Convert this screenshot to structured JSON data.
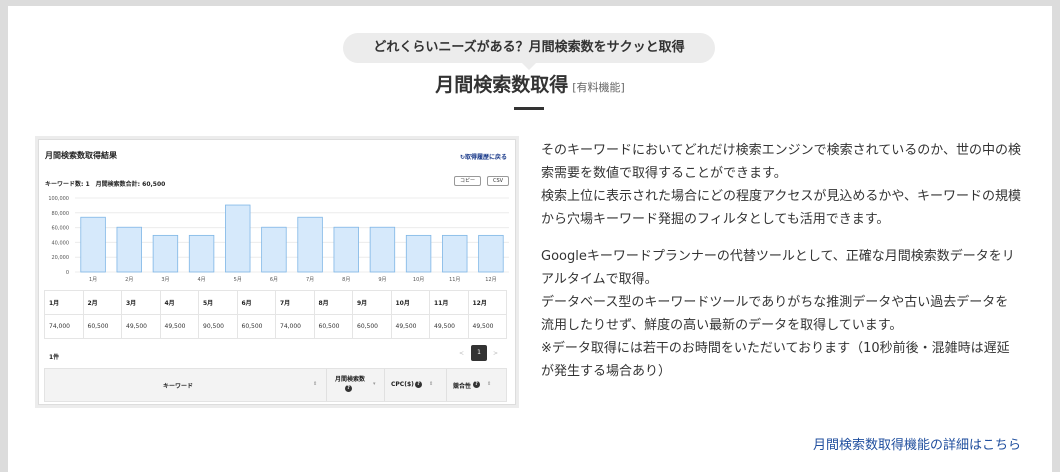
{
  "header": {
    "bubble": "どれくらいニーズがある？月間検索数をサクッと取得",
    "title": "月間検索数取得",
    "title_tag": "[有料機能]"
  },
  "screenshot": {
    "title": "月間検索数取得結果",
    "back_link": "取得履歴に戻る",
    "keyword_count": "キーワード数: 1",
    "monthly_total": "月間検索数合計: 60,500",
    "copy_button": "コピー",
    "csv_button": "CSV",
    "result_count": "1件",
    "page": "1",
    "prev": "<",
    "next": ">",
    "months": [
      "1月",
      "2月",
      "3月",
      "4月",
      "5月",
      "6月",
      "7月",
      "8月",
      "9月",
      "10月",
      "11月",
      "12月"
    ],
    "month_values": [
      "74,000",
      "60,500",
      "49,500",
      "49,500",
      "90,500",
      "60,500",
      "74,000",
      "60,500",
      "60,500",
      "49,500",
      "49,500",
      "49,500"
    ],
    "keyword_table_headers": {
      "keyword": "キーワード",
      "monthly_search": "月間検索数",
      "cpc": "CPC($)",
      "competition": "競合性",
      "help": "?",
      "sort_mark": "⇕",
      "sort_desc": "▾"
    }
  },
  "chart_data": {
    "type": "bar",
    "categories": [
      "1月",
      "2月",
      "3月",
      "4月",
      "5月",
      "6月",
      "7月",
      "8月",
      "9月",
      "10月",
      "11月",
      "12月"
    ],
    "values": [
      74000,
      60500,
      49500,
      49500,
      90500,
      60500,
      74000,
      60500,
      60500,
      49500,
      49500,
      49500
    ],
    "ylim": [
      0,
      100000
    ],
    "yticks": [
      "0",
      "20,000",
      "40,000",
      "60,000",
      "80,000",
      "100,000"
    ],
    "grid": true,
    "colors": {
      "fill": "#d6e9fb",
      "stroke": "#7fb6e6"
    }
  },
  "description": {
    "p1": "そのキーワードにおいてどれだけ検索エンジンで検索されているのか、世の中の検索需要を数値で取得することができます。",
    "p1b": "検索上位に表示された場合にどの程度アクセスが見込めるかや、キーワードの規模から穴場キーワード発掘のフィルタとしても活用できます。",
    "p2": "Googleキーワードプランナーの代替ツールとして、正確な月間検索数データをリアルタイムで取得。",
    "p2b": "データベース型のキーワードツールでありがちな推測データや古い過去データを流用したりせず、鮮度の高い最新のデータを取得しています。",
    "p2c": "※データ取得には若干のお時間をいただいております（10秒前後・混雑時は遅延が発生する場合あり）"
  },
  "detail_link": "月間検索数取得機能の詳細はこちら"
}
